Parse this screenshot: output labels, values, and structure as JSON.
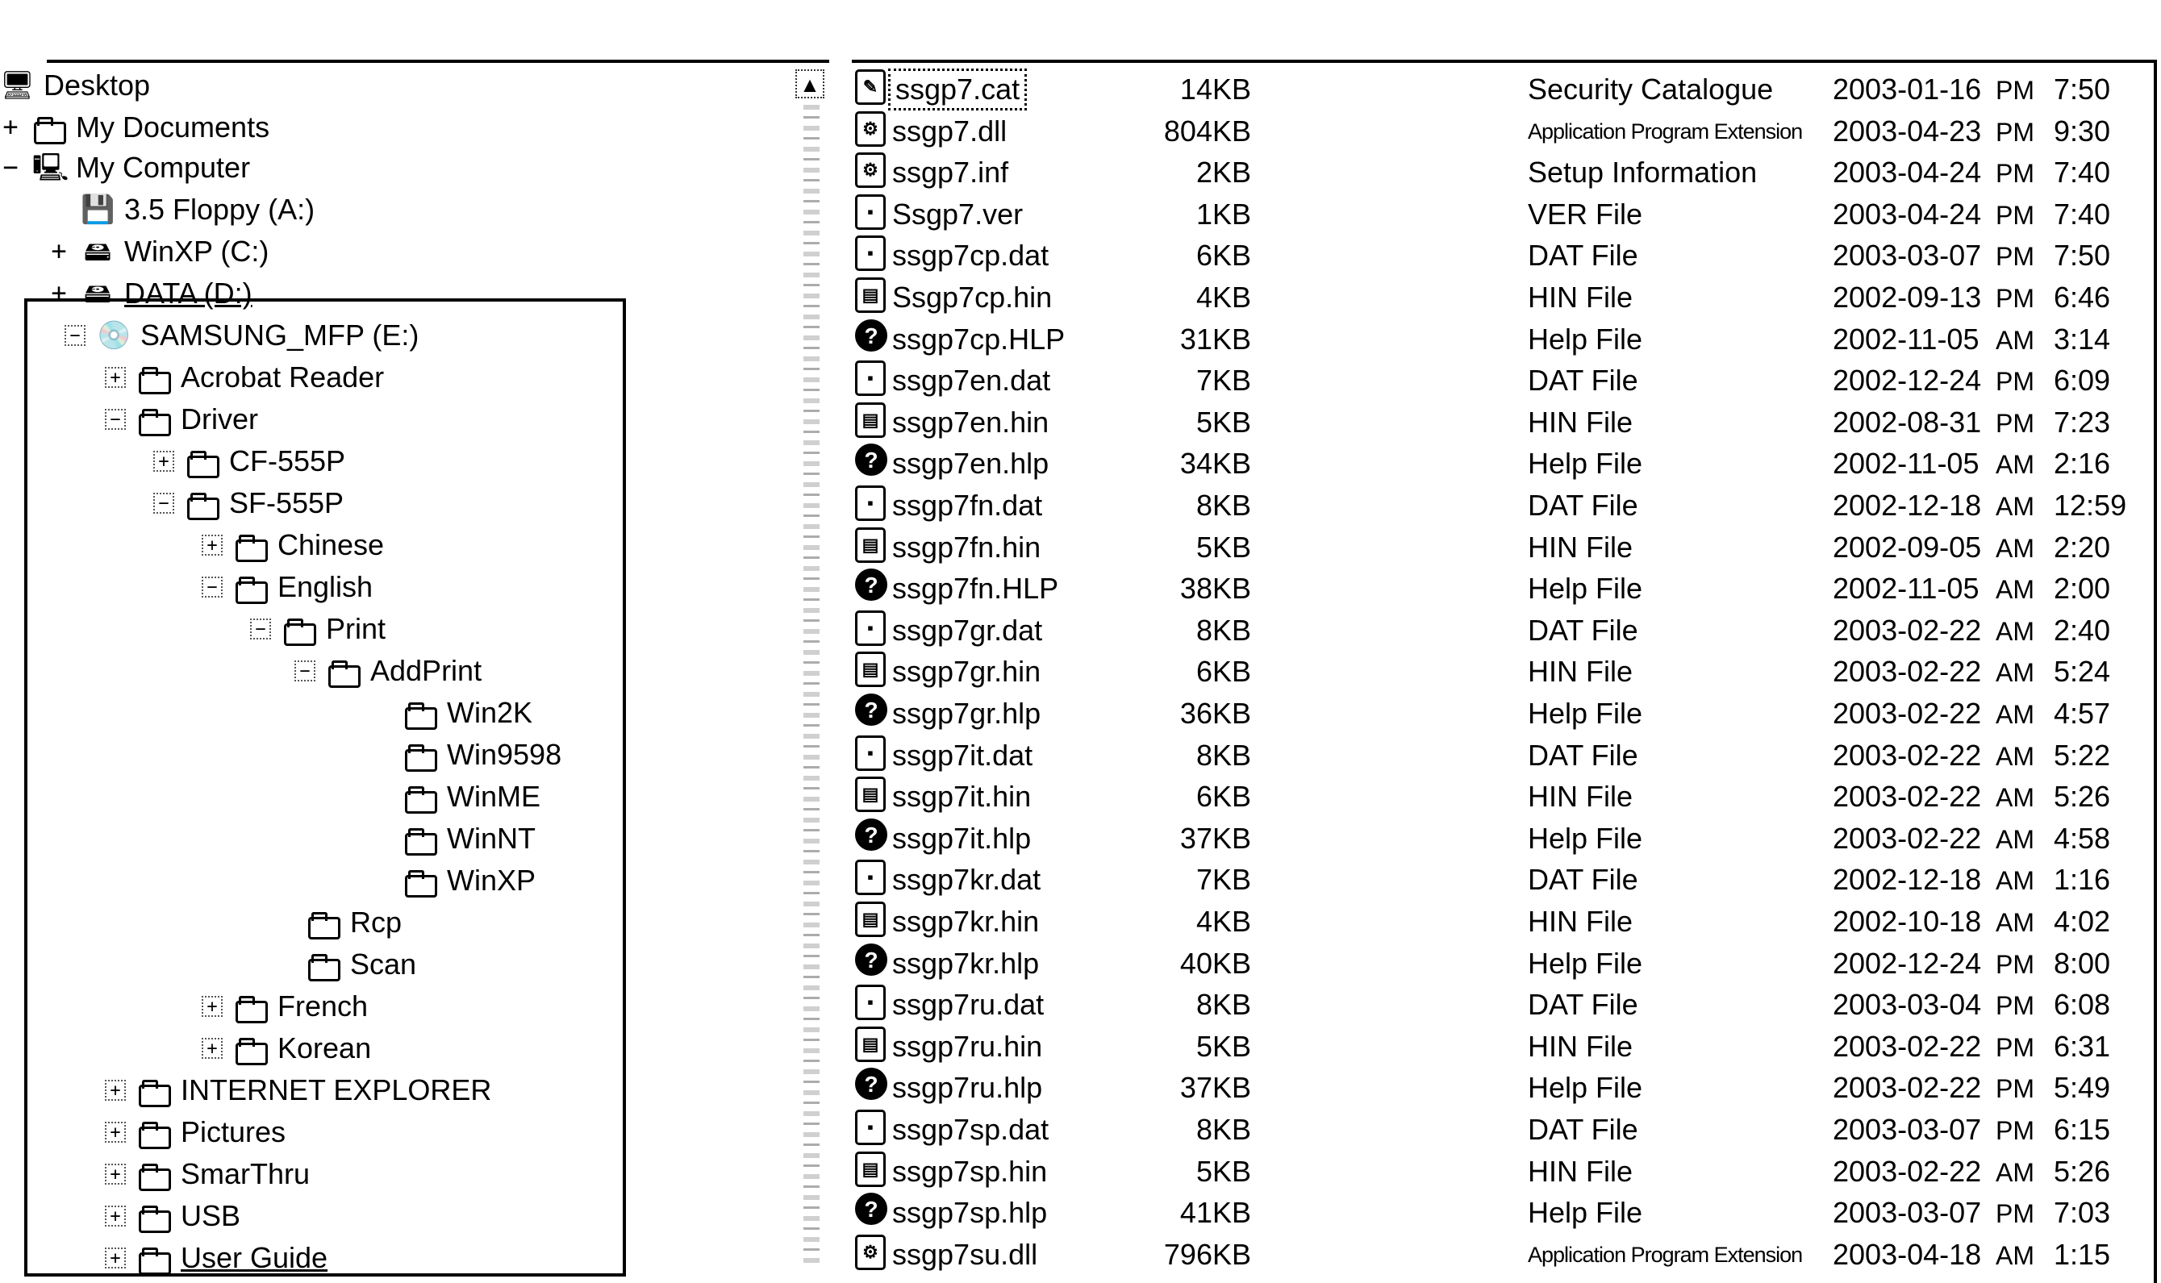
{
  "tree": {
    "items": [
      {
        "label": "Desktop",
        "expander": "",
        "icon": "desktop-icon",
        "glyph": "🖥"
      },
      {
        "label": "My Documents",
        "expander": "+",
        "icon": "folder-icon",
        "glyph": ""
      },
      {
        "label": "My Computer",
        "expander": "−",
        "icon": "computer-icon",
        "glyph": "🖳"
      },
      {
        "label": "3.5 Floppy (A:)",
        "expander": "",
        "icon": "floppy-icon",
        "glyph": "💾"
      },
      {
        "label": "WinXP (C:)",
        "expander": "+",
        "icon": "hard-drive-icon",
        "glyph": "🖴"
      },
      {
        "label": "DATA (D:)",
        "expander": "+",
        "icon": "hard-drive-icon",
        "glyph": "🖴"
      },
      {
        "label": "SAMSUNG_MFP (E:)",
        "expander": "−",
        "icon": "cd-drive-icon",
        "glyph": "💿"
      },
      {
        "label": "Acrobat Reader",
        "expander": "+",
        "icon": "folder-icon",
        "glyph": ""
      },
      {
        "label": "Driver",
        "expander": "−",
        "icon": "folder-icon",
        "glyph": ""
      },
      {
        "label": "CF-555P",
        "expander": "+",
        "icon": "folder-icon",
        "glyph": ""
      },
      {
        "label": "SF-555P",
        "expander": "−",
        "icon": "folder-icon",
        "glyph": ""
      },
      {
        "label": "Chinese",
        "expander": "+",
        "icon": "folder-icon",
        "glyph": ""
      },
      {
        "label": "English",
        "expander": "−",
        "icon": "folder-icon",
        "glyph": ""
      },
      {
        "label": "Print",
        "expander": "−",
        "icon": "folder-icon",
        "glyph": ""
      },
      {
        "label": "AddPrint",
        "expander": "−",
        "icon": "folder-icon",
        "glyph": ""
      },
      {
        "label": "Win2K",
        "expander": "",
        "icon": "folder-icon",
        "glyph": ""
      },
      {
        "label": "Win9598",
        "expander": "",
        "icon": "folder-icon",
        "glyph": ""
      },
      {
        "label": "WinME",
        "expander": "",
        "icon": "folder-icon",
        "glyph": ""
      },
      {
        "label": "WinNT",
        "expander": "",
        "icon": "folder-icon",
        "glyph": ""
      },
      {
        "label": "WinXP",
        "expander": "",
        "icon": "folder-icon",
        "glyph": ""
      },
      {
        "label": "Rcp",
        "expander": "",
        "icon": "folder-icon",
        "glyph": ""
      },
      {
        "label": "Scan",
        "expander": "",
        "icon": "folder-icon",
        "glyph": ""
      },
      {
        "label": "French",
        "expander": "+",
        "icon": "folder-icon",
        "glyph": ""
      },
      {
        "label": "Korean",
        "expander": "+",
        "icon": "folder-icon",
        "glyph": ""
      },
      {
        "label": "INTERNET EXPLORER",
        "expander": "+",
        "icon": "folder-icon",
        "glyph": ""
      },
      {
        "label": "Pictures",
        "expander": "+",
        "icon": "folder-icon",
        "glyph": ""
      },
      {
        "label": "SmarThru",
        "expander": "+",
        "icon": "folder-icon",
        "glyph": ""
      },
      {
        "label": "USB",
        "expander": "+",
        "icon": "folder-icon",
        "glyph": ""
      },
      {
        "label": "User Guide",
        "expander": "+",
        "icon": "folder-icon",
        "glyph": ""
      }
    ]
  },
  "scrollbar": {
    "up_arrow": "▲"
  },
  "files": [
    {
      "name": "ssgp7.cat",
      "size": "14KB",
      "type": "Security Catalogue",
      "date": "2003-01-16",
      "ampm": "PM",
      "time": "7:50",
      "icon": "catalog-file-icon",
      "glyph": "✎"
    },
    {
      "name": "ssgp7.dll",
      "size": "804KB",
      "type": "Application Program Extension",
      "date": "2003-04-23",
      "ampm": "PM",
      "time": "9:30",
      "icon": "dll-file-icon",
      "glyph": "⚙"
    },
    {
      "name": "ssgp7.inf",
      "size": "2KB",
      "type": "Setup Information",
      "date": "2003-04-24",
      "ampm": "PM",
      "time": "7:40",
      "icon": "setup-file-icon",
      "glyph": "⚙"
    },
    {
      "name": "Ssgp7.ver",
      "size": "1KB",
      "type": "VER File",
      "date": "2003-04-24",
      "ampm": "PM",
      "time": "7:40",
      "icon": "generic-file-icon",
      "glyph": "▪"
    },
    {
      "name": "ssgp7cp.dat",
      "size": "6KB",
      "type": "DAT File",
      "date": "2003-03-07",
      "ampm": "PM",
      "time": "7:50",
      "icon": "generic-file-icon",
      "glyph": "▪"
    },
    {
      "name": "Ssgp7cp.hin",
      "size": "4KB",
      "type": "HIN  File",
      "date": "2002-09-13",
      "ampm": "PM",
      "time": "6:46",
      "icon": "hin-file-icon",
      "glyph": "▤"
    },
    {
      "name": "ssgp7cp.HLP",
      "size": "31KB",
      "type": "Help File",
      "date": "2002-11-05",
      "ampm": "AM",
      "time": "3:14",
      "icon": "help-file-icon",
      "glyph": "?"
    },
    {
      "name": "ssgp7en.dat",
      "size": "7KB",
      "type": "DAT File",
      "date": "2002-12-24",
      "ampm": "PM",
      "time": "6:09",
      "icon": "generic-file-icon",
      "glyph": "▪"
    },
    {
      "name": "ssgp7en.hin",
      "size": "5KB",
      "type": "HIN  File",
      "date": "2002-08-31",
      "ampm": "PM",
      "time": "7:23",
      "icon": "hin-file-icon",
      "glyph": "▤"
    },
    {
      "name": "ssgp7en.hlp",
      "size": "34KB",
      "type": "Help File",
      "date": "2002-11-05",
      "ampm": "AM",
      "time": "2:16",
      "icon": "help-file-icon",
      "glyph": "?"
    },
    {
      "name": "ssgp7fn.dat",
      "size": "8KB",
      "type": "DAT File",
      "date": "2002-12-18",
      "ampm": "AM",
      "time": "12:59",
      "icon": "generic-file-icon",
      "glyph": "▪"
    },
    {
      "name": "ssgp7fn.hin",
      "size": "5KB",
      "type": "HIN  File",
      "date": "2002-09-05",
      "ampm": "AM",
      "time": "2:20",
      "icon": "hin-file-icon",
      "glyph": "▤"
    },
    {
      "name": "ssgp7fn.HLP",
      "size": "38KB",
      "type": "Help File",
      "date": "2002-11-05",
      "ampm": "AM",
      "time": "2:00",
      "icon": "help-file-icon",
      "glyph": "?"
    },
    {
      "name": "ssgp7gr.dat",
      "size": "8KB",
      "type": "DAT File",
      "date": "2003-02-22",
      "ampm": "AM",
      "time": "2:40",
      "icon": "generic-file-icon",
      "glyph": "▪"
    },
    {
      "name": "ssgp7gr.hin",
      "size": "6KB",
      "type": "HIN  File",
      "date": "2003-02-22",
      "ampm": "AM",
      "time": "5:24",
      "icon": "hin-file-icon",
      "glyph": "▤"
    },
    {
      "name": "ssgp7gr.hlp",
      "size": "36KB",
      "type": "Help File",
      "date": "2003-02-22",
      "ampm": "AM",
      "time": "4:57",
      "icon": "help-file-icon",
      "glyph": "?"
    },
    {
      "name": "ssgp7it.dat",
      "size": "8KB",
      "type": "DAT File",
      "date": "2003-02-22",
      "ampm": "AM",
      "time": "5:22",
      "icon": "generic-file-icon",
      "glyph": "▪"
    },
    {
      "name": "ssgp7it.hin",
      "size": "6KB",
      "type": "HIN  File",
      "date": "2003-02-22",
      "ampm": "AM",
      "time": "5:26",
      "icon": "hin-file-icon",
      "glyph": "▤"
    },
    {
      "name": "ssgp7it.hlp",
      "size": "37KB",
      "type": "Help File",
      "date": "2003-02-22",
      "ampm": "AM",
      "time": "4:58",
      "icon": "help-file-icon",
      "glyph": "?"
    },
    {
      "name": "ssgp7kr.dat",
      "size": "7KB",
      "type": "DAT File",
      "date": "2002-12-18",
      "ampm": "AM",
      "time": "1:16",
      "icon": "generic-file-icon",
      "glyph": "▪"
    },
    {
      "name": "ssgp7kr.hin",
      "size": "4KB",
      "type": "HIN  File",
      "date": "2002-10-18",
      "ampm": "AM",
      "time": "4:02",
      "icon": "hin-file-icon",
      "glyph": "▤"
    },
    {
      "name": "ssgp7kr.hlp",
      "size": "40KB",
      "type": "Help File",
      "date": "2002-12-24",
      "ampm": "PM",
      "time": "8:00",
      "icon": "help-file-icon",
      "glyph": "?"
    },
    {
      "name": "ssgp7ru.dat",
      "size": "8KB",
      "type": "DAT File",
      "date": "2003-03-04",
      "ampm": "PM",
      "time": "6:08",
      "icon": "generic-file-icon",
      "glyph": "▪"
    },
    {
      "name": "ssgp7ru.hin",
      "size": "5KB",
      "type": "HIN  File",
      "date": "2003-02-22",
      "ampm": "PM",
      "time": "6:31",
      "icon": "hin-file-icon",
      "glyph": "▤"
    },
    {
      "name": "ssgp7ru.hlp",
      "size": "37KB",
      "type": "Help File",
      "date": "2003-02-22",
      "ampm": "PM",
      "time": "5:49",
      "icon": "help-file-icon",
      "glyph": "?"
    },
    {
      "name": "ssgp7sp.dat",
      "size": "8KB",
      "type": "DAT File",
      "date": "2003-03-07",
      "ampm": "PM",
      "time": "6:15",
      "icon": "generic-file-icon",
      "glyph": "▪"
    },
    {
      "name": "ssgp7sp.hin",
      "size": "5KB",
      "type": "HIN  File",
      "date": "2003-02-22",
      "ampm": "AM",
      "time": "5:26",
      "icon": "hin-file-icon",
      "glyph": "▤"
    },
    {
      "name": "ssgp7sp.hlp",
      "size": "41KB",
      "type": "Help File",
      "date": "2003-03-07",
      "ampm": "PM",
      "time": "7:03",
      "icon": "help-file-icon",
      "glyph": "?"
    },
    {
      "name": "ssgp7su.dll",
      "size": "796KB",
      "type": "Application Program Extension",
      "date": "2003-04-18",
      "ampm": "AM",
      "time": "1:15",
      "icon": "dll-file-icon",
      "glyph": "⚙"
    }
  ]
}
